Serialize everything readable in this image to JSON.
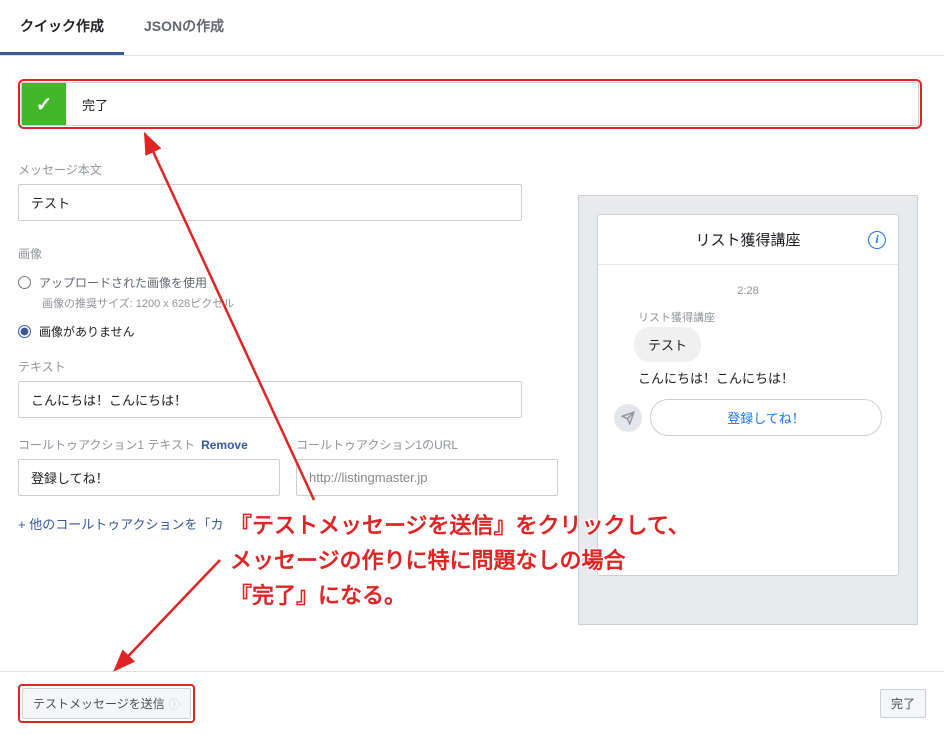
{
  "tabs": {
    "quick": "クイック作成",
    "json": "JSONの作成"
  },
  "status": {
    "label": "完了"
  },
  "message_body": {
    "label": "メッセージ本文",
    "value": "テスト"
  },
  "image": {
    "section_label": "画像",
    "radio_upload": "アップロードされた画像を使用",
    "hint": "画像の推奨サイズ: 1200 x 628ピクセル",
    "radio_none": "画像がありません"
  },
  "text": {
    "label": "テキスト",
    "value": "こんにちは！こんにちは！"
  },
  "cta1": {
    "text_label": "コールトゥアクション1 テキスト",
    "remove": "Remove",
    "text_value": "登録してね！",
    "url_label": "コールトゥアクション1のURL",
    "url_value": "http://listingmaster.jp"
  },
  "add_cta": "+ 他のコールトゥアクションを「カ",
  "preview": {
    "title": "リスト獲得講座",
    "time": "2:28",
    "sender": "リスト獲得講座",
    "bubble": "テスト",
    "line": "こんにちは！こんにちは！",
    "cta_btn": "登録してね！"
  },
  "footer": {
    "test_btn": "テストメッセージを送信",
    "done_btn": "完了"
  },
  "annotation": {
    "line1": "『テストメッセージを送信』をクリックして、",
    "line2": "メッセージの作りに特に問題なしの場合",
    "line3": "『完了』になる。"
  }
}
